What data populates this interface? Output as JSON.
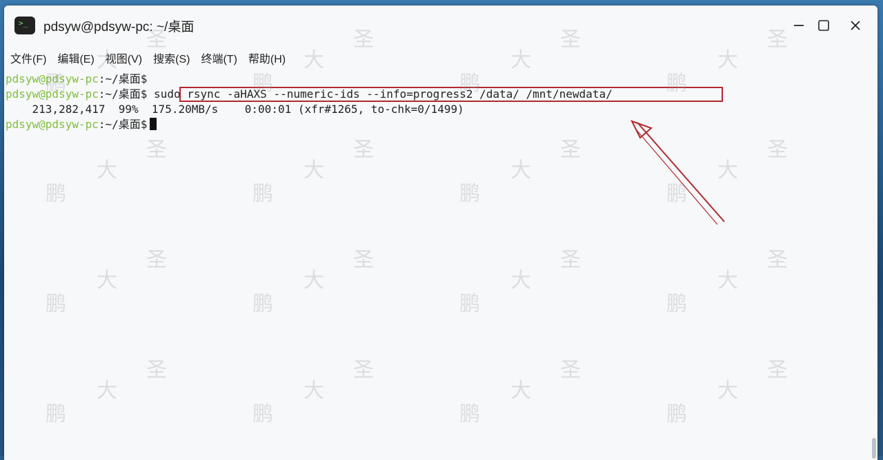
{
  "window": {
    "title": "pdsyw@pdsyw-pc: ~/桌面",
    "icon": "terminal-icon"
  },
  "controls": {
    "minimize_icon": "minimize-icon",
    "maximize_icon": "maximize-icon",
    "close_icon": "close-icon"
  },
  "menu": [
    {
      "label": "文件(F)"
    },
    {
      "label": "编辑(E)"
    },
    {
      "label": "视图(V)"
    },
    {
      "label": "搜索(S)"
    },
    {
      "label": "终端(T)"
    },
    {
      "label": "帮助(H)"
    }
  ],
  "terminal": {
    "prompt": "pdsyw@pdsyw-pc",
    "path_sep": ":~/桌面$",
    "lines": [
      {
        "prompt": "pdsyw@pdsyw-pc",
        "sep": ":~/桌面$",
        "command": ""
      },
      {
        "prompt": "pdsyw@pdsyw-pc",
        "sep": ":~/桌面$",
        "command": "sudo rsync -aHAXS --numeric-ids --info=progress2 /data/ /mnt/newdata/"
      },
      {
        "output": "    213,282,417  99%  175.20MB/s    0:00:01 (xfr#1265, to-chk=0/1499)"
      },
      {
        "prompt": "pdsyw@pdsyw-pc",
        "sep": ":~/桌面$",
        "command": ""
      }
    ]
  },
  "annotation": {
    "box_color": "#b3282d",
    "arrow_color": "#b3282d"
  },
  "watermark": {
    "chars": [
      "鹏",
      "大",
      "圣"
    ]
  },
  "colors": {
    "prompt": "#7fbf3a",
    "text": "#222222",
    "background": "#f7f8fa"
  }
}
